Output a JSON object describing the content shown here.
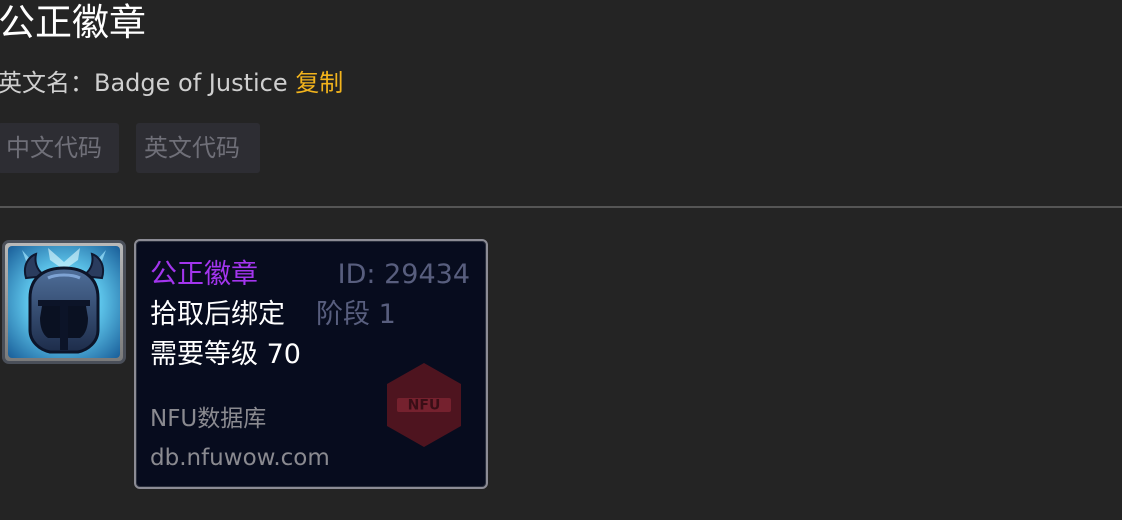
{
  "page": {
    "title": "公正徽章",
    "english_name_label": "英文名：",
    "english_name": "Badge of Justice",
    "copy_label": "复制"
  },
  "code_buttons": {
    "chinese": "中文代码",
    "english": "英文代码"
  },
  "tooltip": {
    "item_name": "公正徽章",
    "item_id": "ID: 29434",
    "binding": "拾取后绑定",
    "stage": "阶段 1",
    "required_level": "需要等级 70",
    "database_name": "NFU数据库",
    "database_url": "db.nfuwow.com",
    "watermark_text": "NFU"
  },
  "colors": {
    "background": "#242424",
    "copy_link": "#f3b41c",
    "epic_quality": "#a335ee",
    "tooltip_background": "#070c1e",
    "muted_text": "#585e7e"
  },
  "icons": {
    "item_icon": "badge-of-justice-helmet-icon",
    "watermark": "nfu-hexagon-logo"
  }
}
